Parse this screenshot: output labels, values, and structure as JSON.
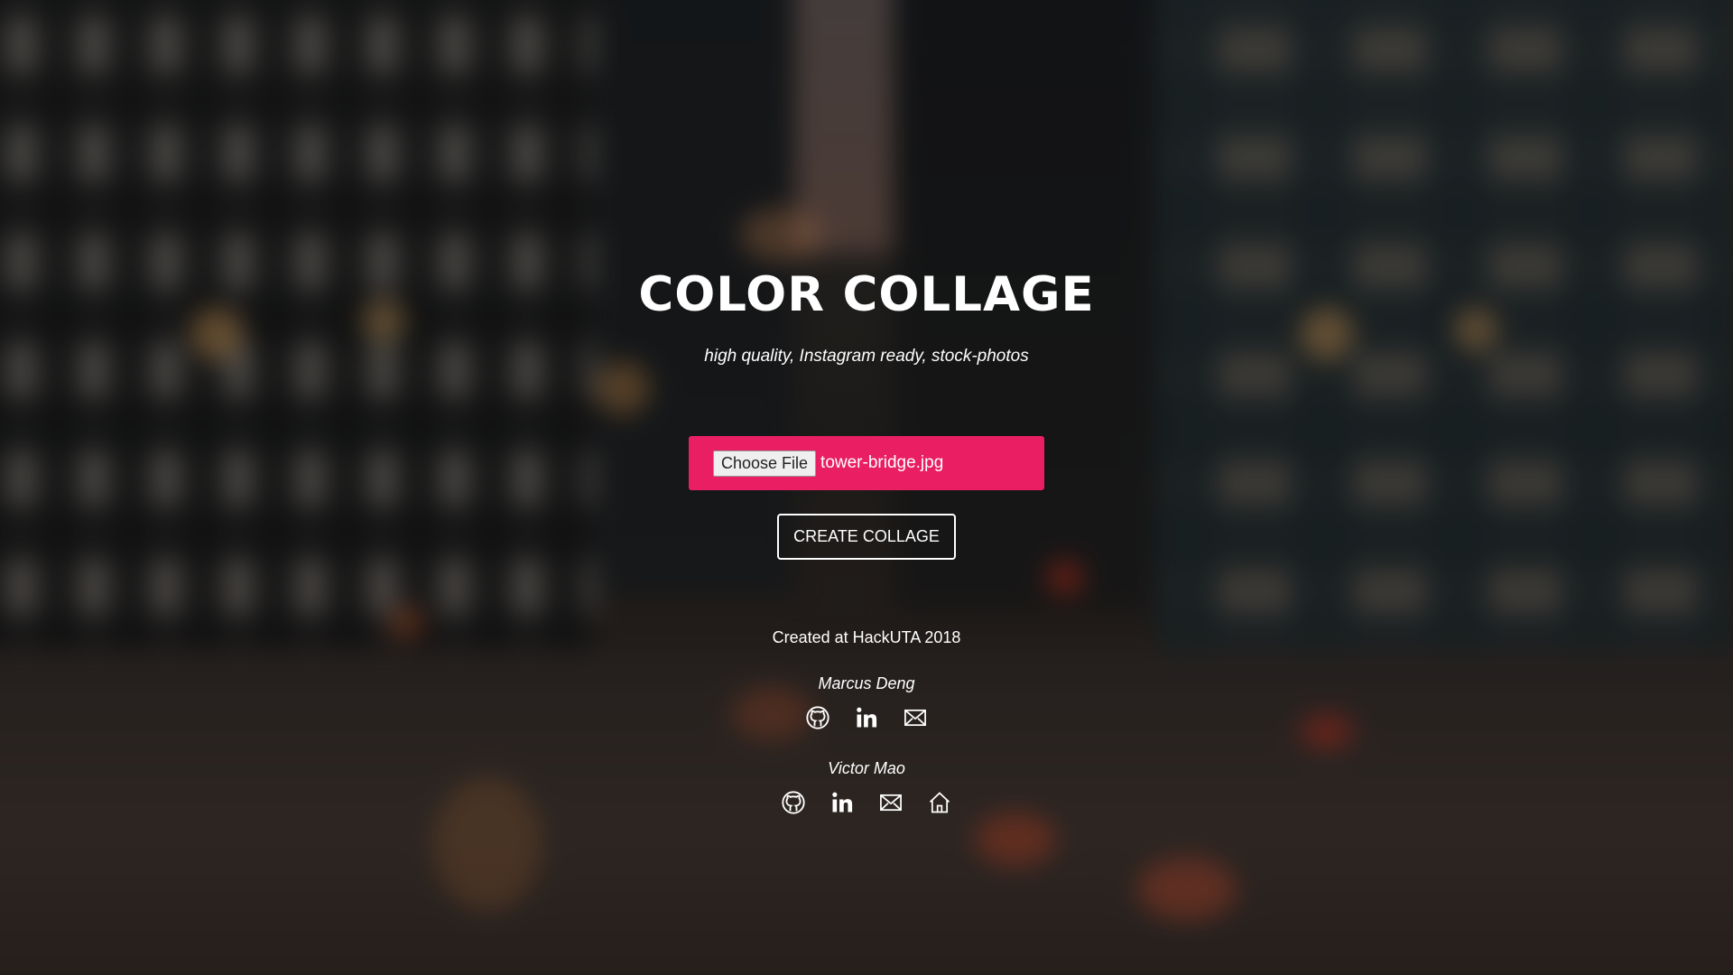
{
  "header": {
    "title": "COLOR COLLAGE",
    "subtitle": "high quality, Instagram ready, stock-photos"
  },
  "upload": {
    "button_label": "Choose File",
    "file_name": "tower-bridge.jpg"
  },
  "actions": {
    "create_label": "CREATE COLLAGE"
  },
  "footer": {
    "credit": "Created at HackUTA 2018",
    "people": [
      {
        "name": "Marcus Deng",
        "icons": [
          "github-icon",
          "linkedin-icon",
          "mail-icon"
        ]
      },
      {
        "name": "Victor Mao",
        "icons": [
          "github-icon",
          "linkedin-icon",
          "mail-icon",
          "home-icon"
        ]
      }
    ]
  },
  "colors": {
    "accent": "#e91e63",
    "text": "#ffffff"
  }
}
